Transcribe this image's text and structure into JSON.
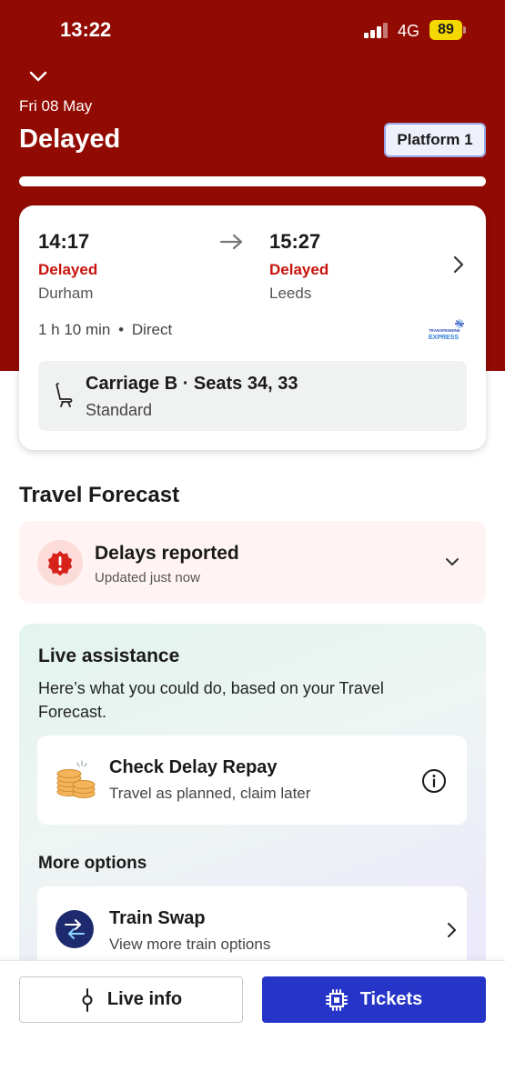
{
  "status_bar": {
    "time": "13:22",
    "network": "4G",
    "battery": "89"
  },
  "header": {
    "date": "Fri 08 May",
    "status": "Delayed",
    "platform": "Platform 1"
  },
  "journey": {
    "departure": {
      "time": "14:17",
      "status": "Delayed",
      "station": "Durham"
    },
    "arrival": {
      "time": "15:27",
      "status": "Delayed",
      "station": "Leeds"
    },
    "duration": "1 h 10 min",
    "separator": "•",
    "type": "Direct",
    "operator_logo_text": [
      "TRANSPENNINE",
      "EXPRESS"
    ],
    "seat": {
      "title": "Carriage B · Seats 34, 33",
      "class": "Standard"
    }
  },
  "forecast": {
    "heading": "Travel Forecast",
    "title": "Delays reported",
    "updated": "Updated just now"
  },
  "assistance": {
    "title": "Live assistance",
    "description": "Here’s what you could do, based on your Travel Forecast.",
    "repay": {
      "title": "Check Delay Repay",
      "subtitle": "Travel as planned, claim later"
    },
    "more_heading": "More options",
    "swap": {
      "title": "Train Swap",
      "subtitle": "View more train options"
    }
  },
  "bottom_bar": {
    "live_info": "Live info",
    "tickets": "Tickets"
  },
  "colors": {
    "header_bg": "#920b02",
    "delayed_text": "#c8120c",
    "primary_button": "#2634c8",
    "battery": "#f4d800"
  }
}
